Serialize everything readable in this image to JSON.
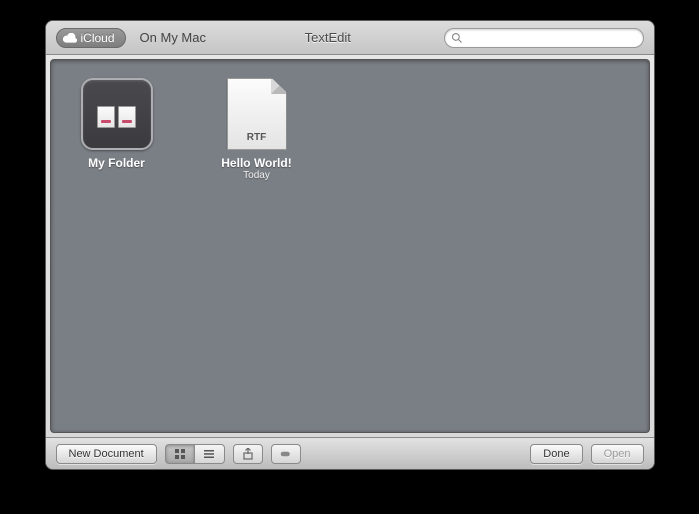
{
  "toolbar": {
    "icloud_label": "iCloud",
    "on_my_mac_label": "On My Mac",
    "app_title": "TextEdit",
    "search_placeholder": ""
  },
  "items": [
    {
      "name": "My Folder",
      "type": "folder",
      "sub": ""
    },
    {
      "name": "Hello World!",
      "type": "rtf",
      "ext_label": "RTF",
      "sub": "Today"
    }
  ],
  "bottombar": {
    "new_document": "New Document",
    "done": "Done",
    "open": "Open"
  }
}
